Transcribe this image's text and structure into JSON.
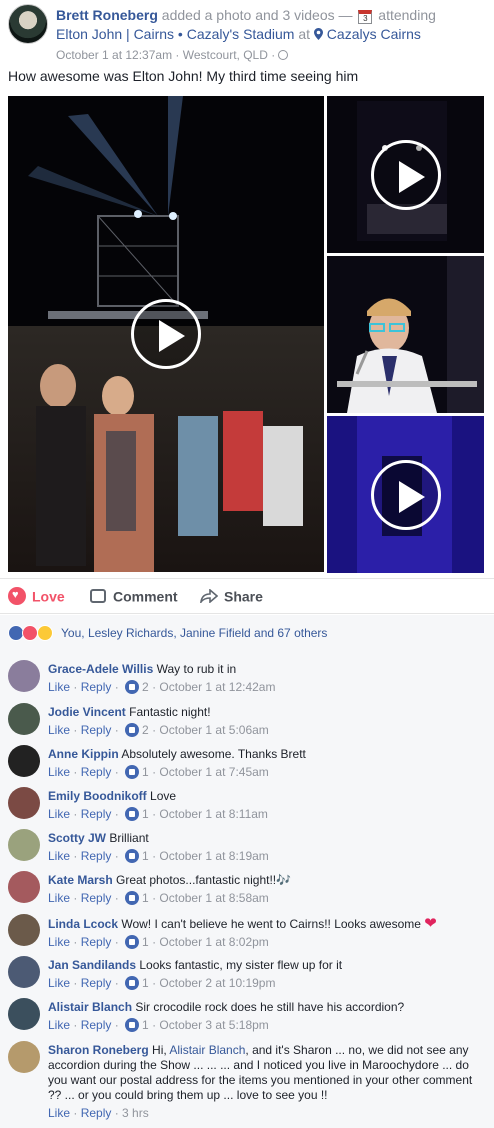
{
  "post": {
    "author": "Brett Roneberg",
    "action": "added a photo and 3 videos —",
    "calendar_day": "3",
    "attending": "attending",
    "event": "Elton John | Cairns • Cazaly's Stadium",
    "at": "at",
    "place": "Cazalys Cairns",
    "meta": "October 1 at 12:37am · Westcourt, QLD ·",
    "text": "How awesome was Elton John! My third time seeing him"
  },
  "actions": {
    "love": "Love",
    "comment": "Comment",
    "share": "Share"
  },
  "reactions": {
    "summary": "You, Lesley Richards, Janine Fifield and 67 others"
  },
  "comments": [
    {
      "name": "Grace-Adele Willis",
      "text": "Way to rub it in",
      "like": "Like",
      "reply": "Reply",
      "count": "2",
      "time": "October 1 at 12:42am",
      "avatar_color": "#8a7d9c"
    },
    {
      "name": "Jodie Vincent",
      "text": "Fantastic night!",
      "like": "Like",
      "reply": "Reply",
      "count": "2",
      "time": "October 1 at 5:06am",
      "avatar_color": "#4a5a4c"
    },
    {
      "name": "Anne Kippin",
      "text": "Absolutely awesome. Thanks Brett",
      "like": "Like",
      "reply": "Reply",
      "count": "1",
      "time": "October 1 at 7:45am",
      "avatar_color": "#222222"
    },
    {
      "name": "Emily Boodnikoff",
      "text": "Love",
      "like": "Like",
      "reply": "Reply",
      "count": "1",
      "time": "October 1 at 8:11am",
      "avatar_color": "#7b4a44"
    },
    {
      "name": "Scotty JW",
      "text": "Brilliant",
      "like": "Like",
      "reply": "Reply",
      "count": "1",
      "time": "October 1 at 8:19am",
      "avatar_color": "#9aa27d"
    },
    {
      "name": "Kate Marsh",
      "text": "Great photos...fantastic night!!🎶",
      "like": "Like",
      "reply": "Reply",
      "count": "1",
      "time": "October 1 at 8:58am",
      "avatar_color": "#a45a5e"
    },
    {
      "name": "Linda Lcock",
      "text": "Wow! I can't believe he went to Cairns!! Looks awesome",
      "like": "Like",
      "reply": "Reply",
      "count": "1",
      "time": "October 1 at 8:02pm",
      "avatar_color": "#6b5a4a"
    },
    {
      "name": "Jan Sandilands",
      "text": "Looks fantastic, my sister flew up for it",
      "like": "Like",
      "reply": "Reply",
      "count": "1",
      "time": "October 2 at 10:19pm",
      "avatar_color": "#4c5a74"
    },
    {
      "name": "Alistair Blanch",
      "text": "Sir crocodile rock does he still have his accordion?",
      "like": "Like",
      "reply": "Reply",
      "count": "1",
      "time": "October 3 at 5:18pm",
      "avatar_color": "#3b4f5d"
    },
    {
      "name": "Sharon Roneberg",
      "text_pre": "Hi,",
      "mention": "Alistair Blanch",
      "text_post": ", and it's Sharon ... no, we did not see any accordion during the Show ... ... ... and I noticed you live in Maroochydore ... do you want our postal address for the items you mentioned in your other comment ?? ... or you could bring them up ... love to see you !!",
      "like": "Like",
      "reply": "Reply",
      "time": "3 hrs",
      "avatar_color": "#b59a6c"
    }
  ]
}
